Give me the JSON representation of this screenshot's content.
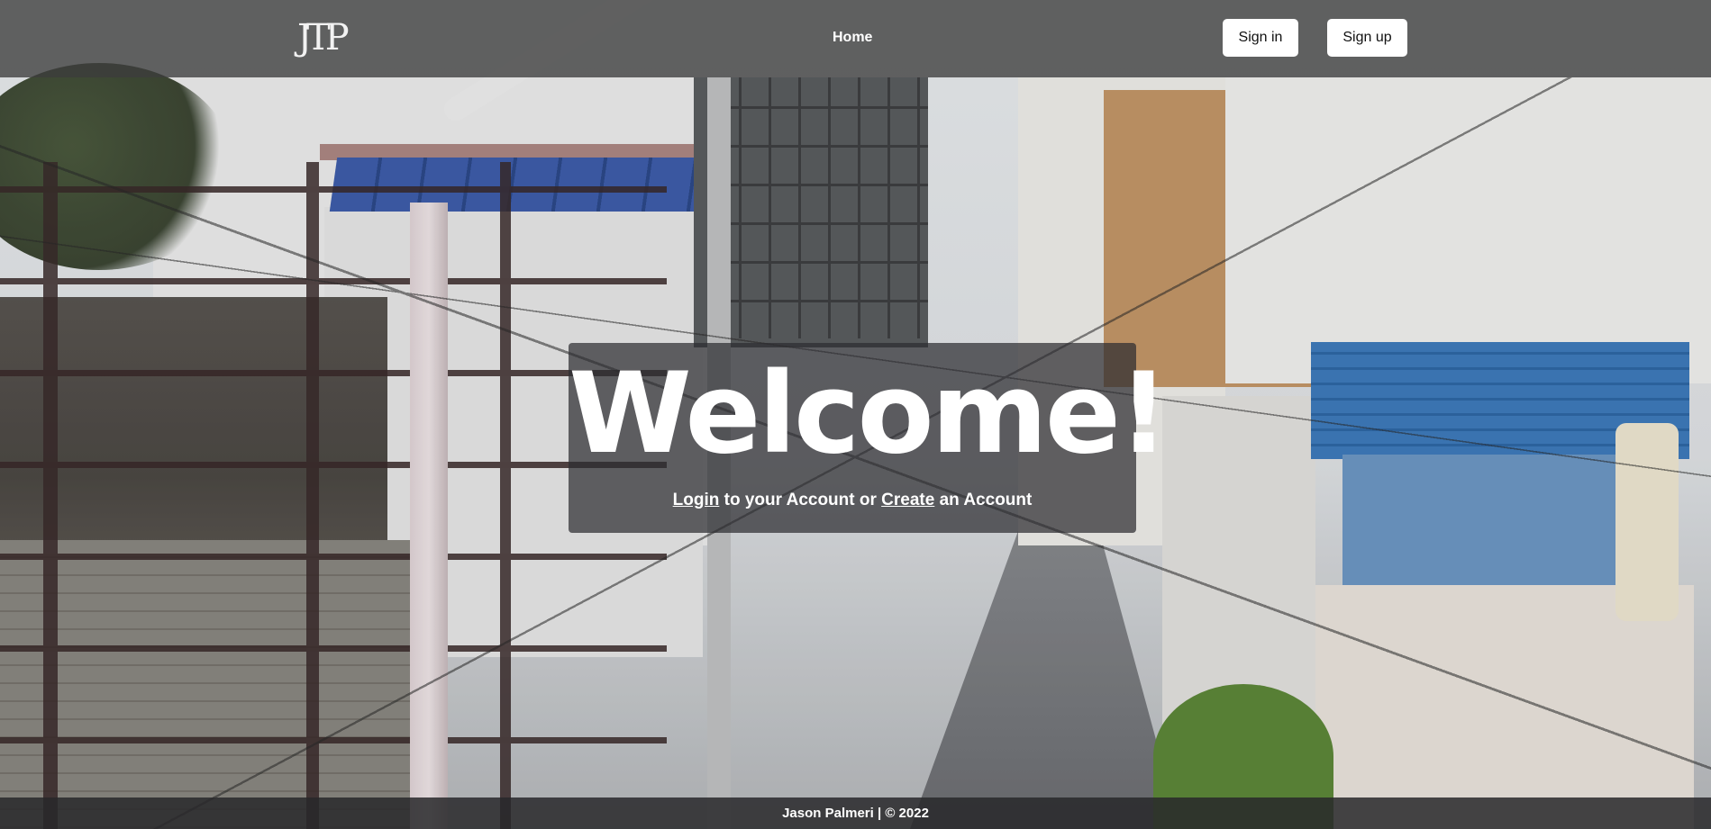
{
  "navbar": {
    "logo_text": "JTP",
    "home_link": "Home",
    "signin_label": "Sign in",
    "signup_label": "Sign up"
  },
  "hero": {
    "title": "Welcome!",
    "login_link": "Login",
    "middle_text": " to your Account or ",
    "create_link": "Create",
    "end_text": " an Account"
  },
  "footer": {
    "text": "Jason Palmeri | © 2022"
  },
  "background": {
    "description_icon": "street-scene-photo"
  }
}
